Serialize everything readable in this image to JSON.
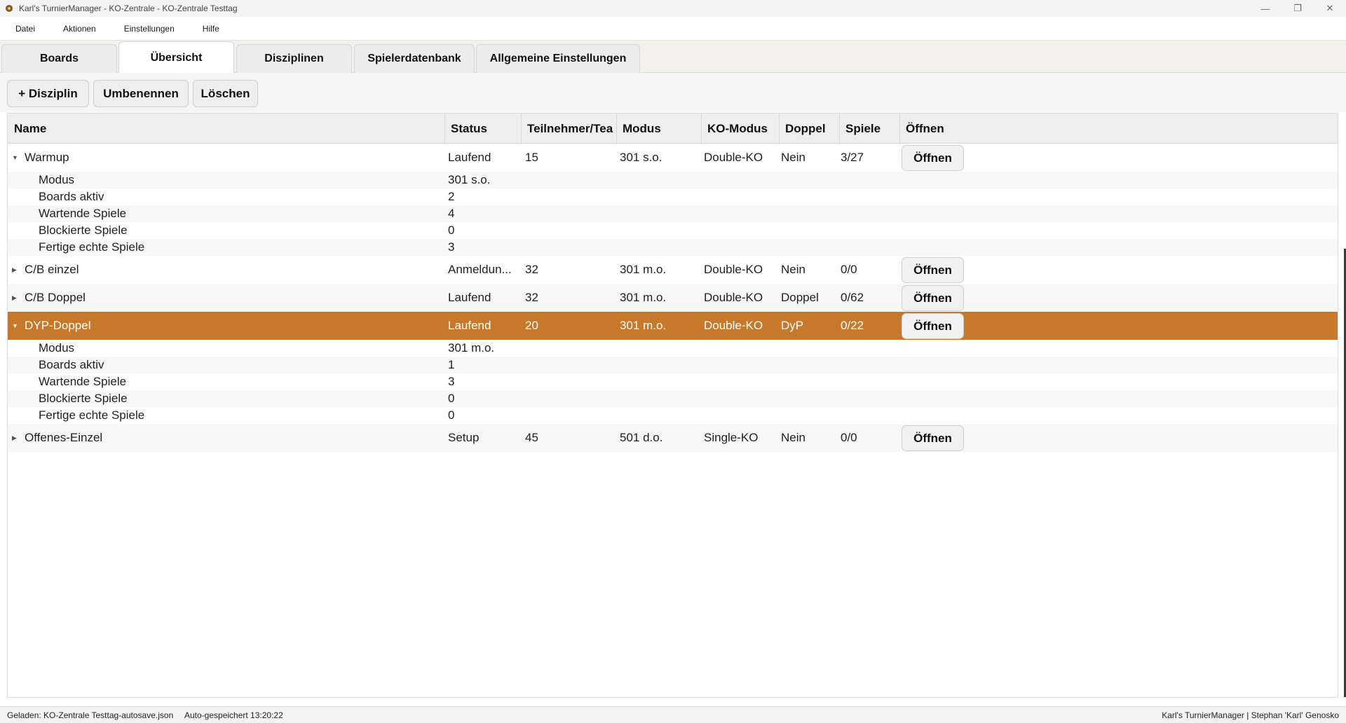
{
  "window": {
    "title": "Karl's TurnierManager - KO-Zentrale - KO-Zentrale Testtag",
    "controls": {
      "minimize": "—",
      "maximize": "❐",
      "close": "✕"
    },
    "icon": "dart-app-icon"
  },
  "menu": {
    "items": [
      "Datei",
      "Aktionen",
      "Einstellungen",
      "Hilfe"
    ]
  },
  "tabs": [
    {
      "label": "Boards",
      "active": false
    },
    {
      "label": "Übersicht",
      "active": true
    },
    {
      "label": "Disziplinen",
      "active": false
    },
    {
      "label": "Spielerdatenbank",
      "active": false
    },
    {
      "label": "Allgemeine Einstellungen",
      "active": false
    }
  ],
  "toolbar": {
    "add_label": "+ Disziplin",
    "rename_label": "Umbenennen",
    "delete_label": "Löschen"
  },
  "table": {
    "headers": {
      "name": "Name",
      "status": "Status",
      "teilnehmer": "Teilnehmer/Tea",
      "modus": "Modus",
      "komodus": "KO-Modus",
      "doppel": "Doppel",
      "spiele": "Spiele",
      "oeffnen": "Öffnen"
    },
    "open_label": "Öffnen",
    "arrows": {
      "expanded": "▼",
      "collapsed": "▶"
    },
    "disciplines": [
      {
        "name": "Warmup",
        "status": "Laufend",
        "teilnehmer": "15",
        "modus": "301 s.o.",
        "komodus": "Double-KO",
        "doppel": "Nein",
        "spiele": "3/27",
        "expanded": true,
        "details": [
          {
            "label": "Modus",
            "value": "301 s.o."
          },
          {
            "label": "Boards aktiv",
            "value": "2"
          },
          {
            "label": "Wartende Spiele",
            "value": "4"
          },
          {
            "label": "Blockierte Spiele",
            "value": "0"
          },
          {
            "label": "Fertige echte Spiele",
            "value": "3"
          }
        ]
      },
      {
        "name": "C/B einzel",
        "status": "Anmeldun...",
        "teilnehmer": "32",
        "modus": "301 m.o.",
        "komodus": "Double-KO",
        "doppel": "Nein",
        "spiele": "0/0",
        "expanded": false
      },
      {
        "name": "C/B Doppel",
        "status": "Laufend",
        "teilnehmer": "32",
        "modus": "301 m.o.",
        "komodus": "Double-KO",
        "doppel": "Doppel",
        "spiele": "0/62",
        "expanded": false
      },
      {
        "name": "DYP-Doppel",
        "status": "Laufend",
        "teilnehmer": "20",
        "modus": "301 m.o.",
        "komodus": "Double-KO",
        "doppel": "DyP",
        "spiele": "0/22",
        "expanded": true,
        "selected": true,
        "details": [
          {
            "label": "Modus",
            "value": "301 m.o."
          },
          {
            "label": "Boards aktiv",
            "value": "1"
          },
          {
            "label": "Wartende Spiele",
            "value": "3"
          },
          {
            "label": "Blockierte Spiele",
            "value": "0"
          },
          {
            "label": "Fertige echte Spiele",
            "value": "0"
          }
        ]
      },
      {
        "name": "Offenes-Einzel",
        "status": "Setup",
        "teilnehmer": "45",
        "modus": "501 d.o.",
        "komodus": "Single-KO",
        "doppel": "Nein",
        "spiele": "0/0",
        "expanded": false
      }
    ]
  },
  "statusbar": {
    "loaded": "Geladen: KO-Zentrale Testtag-autosave.json",
    "autosave": "Auto-gespeichert 13:20:22",
    "credit": "Karl's TurnierManager | Stephan 'Karl' Genosko"
  },
  "colors": {
    "selected_row": "#c8782a",
    "header_bg": "#eeeeee",
    "tab_bar_bg": "#f3f1ec"
  }
}
